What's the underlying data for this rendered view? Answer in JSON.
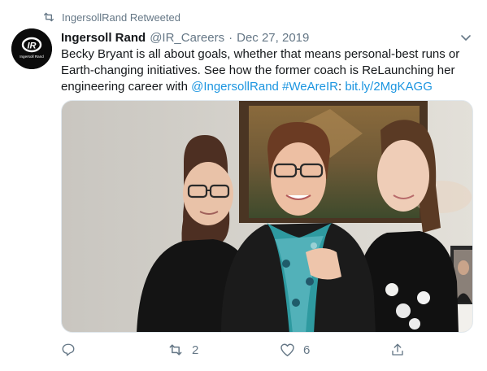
{
  "retweet": {
    "label": "IngersollRand Retweeted"
  },
  "tweet": {
    "author": {
      "name": "Ingersoll Rand",
      "handle": "@IR_Careers"
    },
    "separator": "·",
    "date": "Dec 27, 2019",
    "text": {
      "line1": "Becky Bryant is all about goals, whether that means personal-best runs or",
      "line2": "Earth-changing initiatives. See how the former coach is ReLaunching her",
      "line3_plain": "engineering career with ",
      "mention": "@IngersollRand",
      "space": " ",
      "hashtag": "#WeAreIR",
      "colon": ": ",
      "url": "bit.ly/2MgKAGG"
    },
    "logo": {
      "text": "IR",
      "caption": "Ingersoll Rand"
    }
  },
  "actions": {
    "reply_count": "",
    "retweet_count": "2",
    "like_count": "6"
  },
  "colors": {
    "link": "#1b95e0",
    "muted": "#657786",
    "text": "#14171a"
  }
}
